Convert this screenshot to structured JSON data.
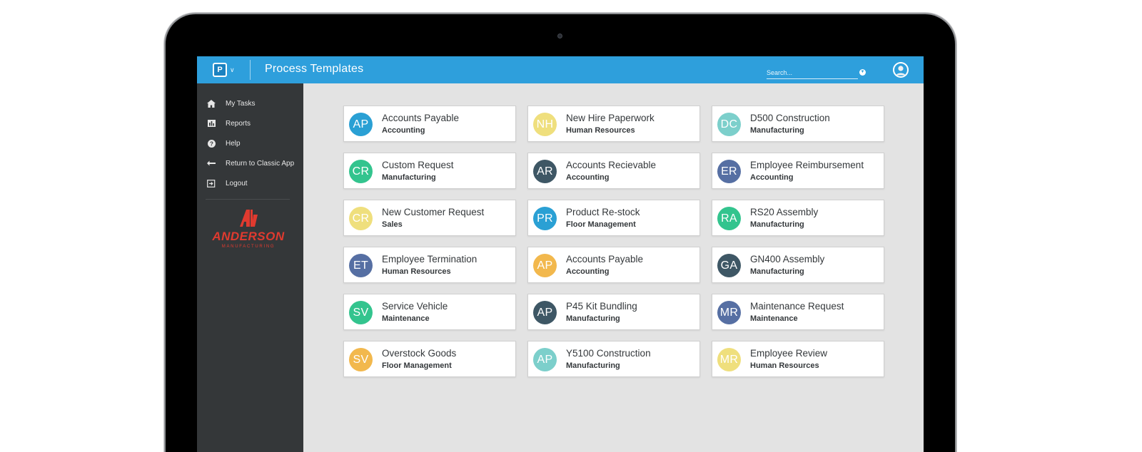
{
  "header": {
    "title": "Process Templates",
    "search_placeholder": "Search...",
    "colors": {
      "bar": "#2e9fdc"
    }
  },
  "sidebar": {
    "items": [
      {
        "label": "My Tasks",
        "icon": "home-icon"
      },
      {
        "label": "Reports",
        "icon": "bar-chart-icon"
      },
      {
        "label": "Help",
        "icon": "help-circle-icon"
      },
      {
        "label": "Return to Classic App",
        "icon": "return-arrow-icon"
      },
      {
        "label": "Logout",
        "icon": "logout-icon"
      }
    ],
    "brand_name": "ANDERSON",
    "brand_sub": "MANUFACTURING"
  },
  "cards": [
    [
      {
        "initials": "AP",
        "title": "Accounts Payable",
        "category": "Accounting",
        "color": "#2aa0d4"
      },
      {
        "initials": "CR",
        "title": "Custom Request",
        "category": "Manufacturing",
        "color": "#33c48e"
      },
      {
        "initials": "CR",
        "title": "New Customer Request",
        "category": "Sales",
        "color": "#efdf7d"
      },
      {
        "initials": "ET",
        "title": "Employee Termination",
        "category": "Human Resources",
        "color": "#566fa3"
      },
      {
        "initials": "SV",
        "title": "Service Vehicle",
        "category": "Maintenance",
        "color": "#33c48e"
      },
      {
        "initials": "SV",
        "title": "Overstock Goods",
        "category": "Floor Management",
        "color": "#f2b84d"
      }
    ],
    [
      {
        "initials": "NH",
        "title": "New Hire Paperwork",
        "category": "Human Resources",
        "color": "#efdf7d"
      },
      {
        "initials": "AR",
        "title": "Accounts Recievable",
        "category": "Accounting",
        "color": "#3e5765"
      },
      {
        "initials": "PR",
        "title": "Product Re-stock",
        "category": "Floor Management",
        "color": "#2aa0d4"
      },
      {
        "initials": "AP",
        "title": "Accounts Payable",
        "category": "Accounting",
        "color": "#f2b84d"
      },
      {
        "initials": "AP",
        "title": "P45 Kit Bundling",
        "category": "Manufacturing",
        "color": "#3e5765"
      },
      {
        "initials": "AP",
        "title": "Y5100 Construction",
        "category": "Manufacturing",
        "color": "#7ccfcb"
      }
    ],
    [
      {
        "initials": "DC",
        "title": "D500 Construction",
        "category": "Manufacturing",
        "color": "#7ccfcb"
      },
      {
        "initials": "ER",
        "title": "Employee Reimbursement",
        "category": "Accounting",
        "color": "#566fa3"
      },
      {
        "initials": "RA",
        "title": "RS20 Assembly",
        "category": "Manufacturing",
        "color": "#33c48e"
      },
      {
        "initials": "GA",
        "title": "GN400 Assembly",
        "category": "Manufacturing",
        "color": "#3e5765"
      },
      {
        "initials": "MR",
        "title": "Maintenance Request",
        "category": "Maintenance",
        "color": "#566fa3"
      },
      {
        "initials": "MR",
        "title": "Employee Review",
        "category": "Human Resources",
        "color": "#efdf7d"
      }
    ]
  ]
}
